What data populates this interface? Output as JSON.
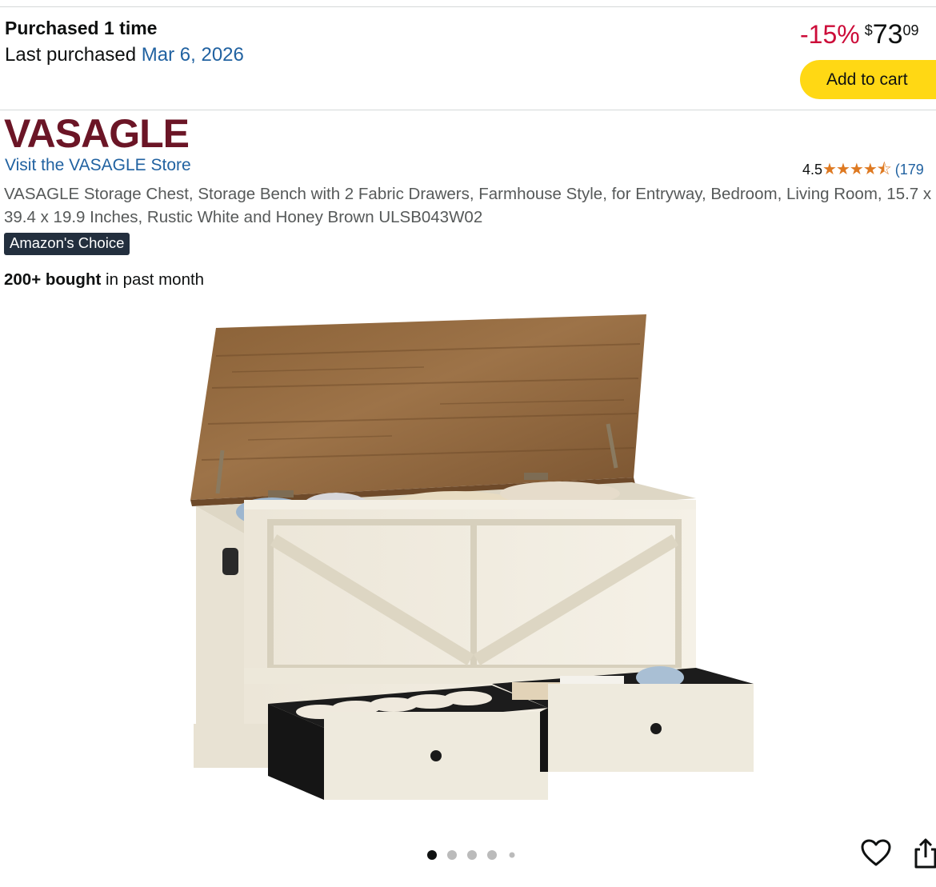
{
  "purchase": {
    "count_text": "Purchased 1 time",
    "last_label": "Last purchased ",
    "last_date": "Mar 6, 2026"
  },
  "price": {
    "discount": "-15%",
    "currency": "$",
    "whole": "73",
    "fraction": "09"
  },
  "buttons": {
    "add_to_cart": "Add to cart"
  },
  "brand": {
    "logo_text": "VASAGLE",
    "store_link": "Visit the VASAGLE Store"
  },
  "rating": {
    "value": "4.5",
    "stars": "★★★★⯪",
    "count": "(179"
  },
  "product": {
    "title": "VASAGLE Storage Chest, Storage Bench with 2 Fabric Drawers, Farmhouse Style, for Entryway, Bedroom, Living Room, 15.7 x 39.4 x 19.9 Inches, Rustic White and Honey Brown ULSB043W02",
    "badge": "Amazon's Choice",
    "bought_bold": "200+ bought",
    "bought_rest": " in past month"
  },
  "carousel": {
    "total": 5,
    "active": 1
  },
  "colors": {
    "link": "#2162a1",
    "discount": "#cc0c39",
    "button_yellow": "#ffd814",
    "brand": "#6b1526",
    "star": "#de7921",
    "badge_bg": "#232f3e"
  },
  "icons": {
    "wishlist": "heart-icon",
    "share": "share-icon"
  }
}
